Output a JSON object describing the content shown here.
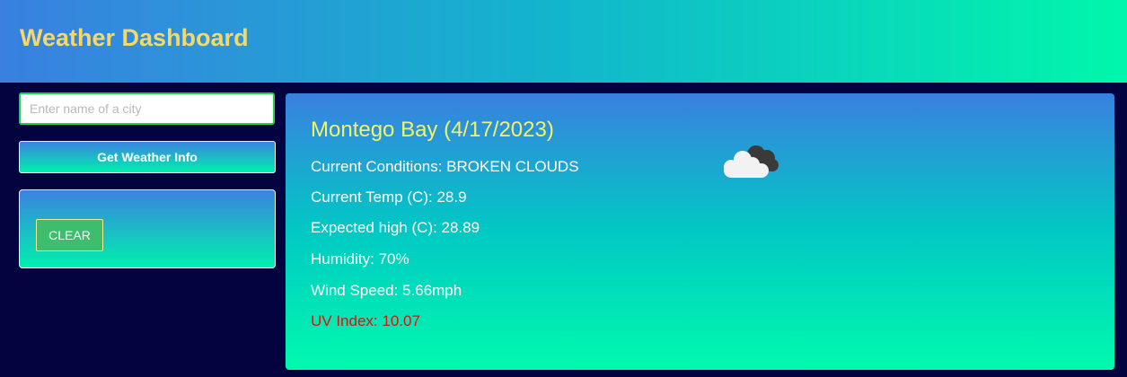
{
  "header": {
    "title": "Weather Dashboard"
  },
  "search": {
    "placeholder": "Enter name of a city",
    "value": "",
    "button_label": "Get Weather Info"
  },
  "history": {
    "clear_label": "CLEAR"
  },
  "weather": {
    "city_title": "Montego Bay (4/17/2023)",
    "icon": "broken-clouds-icon",
    "lines": [
      "Current Conditions: BROKEN CLOUDS",
      "Current Temp (C): 28.9",
      "Expected high (C): 28.89",
      "Humidity: 70%",
      "Wind Speed: 5.66mph"
    ],
    "uv_line": "UV Index: 10.07"
  },
  "colors": {
    "header_title": "#f6d86a",
    "city_title": "#f3f36a",
    "uv_text": "#d3160e",
    "background": "#03033f",
    "clear_button": "#3ebd6e",
    "input_border": "#1fd14f"
  }
}
